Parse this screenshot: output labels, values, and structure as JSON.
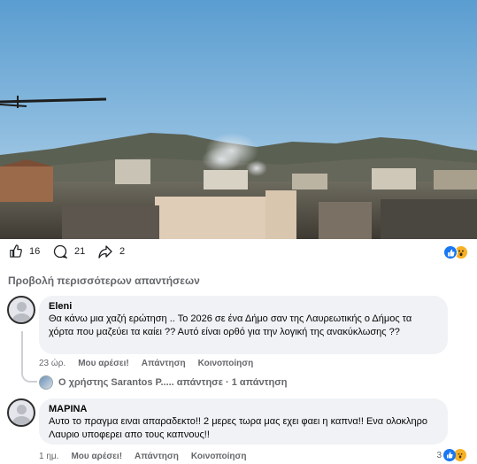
{
  "post": {
    "image": {
      "alt_icon": "photo-landscape-smoke"
    },
    "reactions": {
      "like_count": "16",
      "comment_count": "21",
      "share_count": "2",
      "icons": [
        "like-icon",
        "wow-icon"
      ]
    }
  },
  "more_replies_label": "Προβολή περισσότερων απαντήσεων",
  "comments": [
    {
      "author": "Eleni",
      "text": "Θα κάνω μια χαζή ερώτηση .. Το 2026 σε ένα Δήμο σαν της Λαυρεωτικής ο Δήμος τα χόρτα που μαζεύει τα καίει ?? Αυτό είναι ορθό για την λογική της ανακύκλωσης ??",
      "time": "23 ώρ.",
      "like_label": "Μου αρέσει!",
      "reply_label": "Απάντηση",
      "share_label": "Κοινοποίηση",
      "reply_summary": "Ο χρήστης Sarantos Ρ..... απάντησε · 1 απάντηση"
    },
    {
      "author": "ΜΑΡΙΝΑ",
      "text": "Αυτο το πραγμα ειναι απαραδεκτο!! 2 μερες τωρα μας εχει φαει η καπνα!! Ενα ολοκληρο Λαυριο υποφερει απο τους καπνους!!",
      "time": "1 ημ.",
      "like_label": "Μου αρέσει!",
      "reply_label": "Απάντηση",
      "share_label": "Κοινοποίηση",
      "reaction_count": "3"
    }
  ],
  "colors": {
    "accent": "#1877f2",
    "bubble": "#f0f2f5",
    "muted": "#65676b"
  }
}
